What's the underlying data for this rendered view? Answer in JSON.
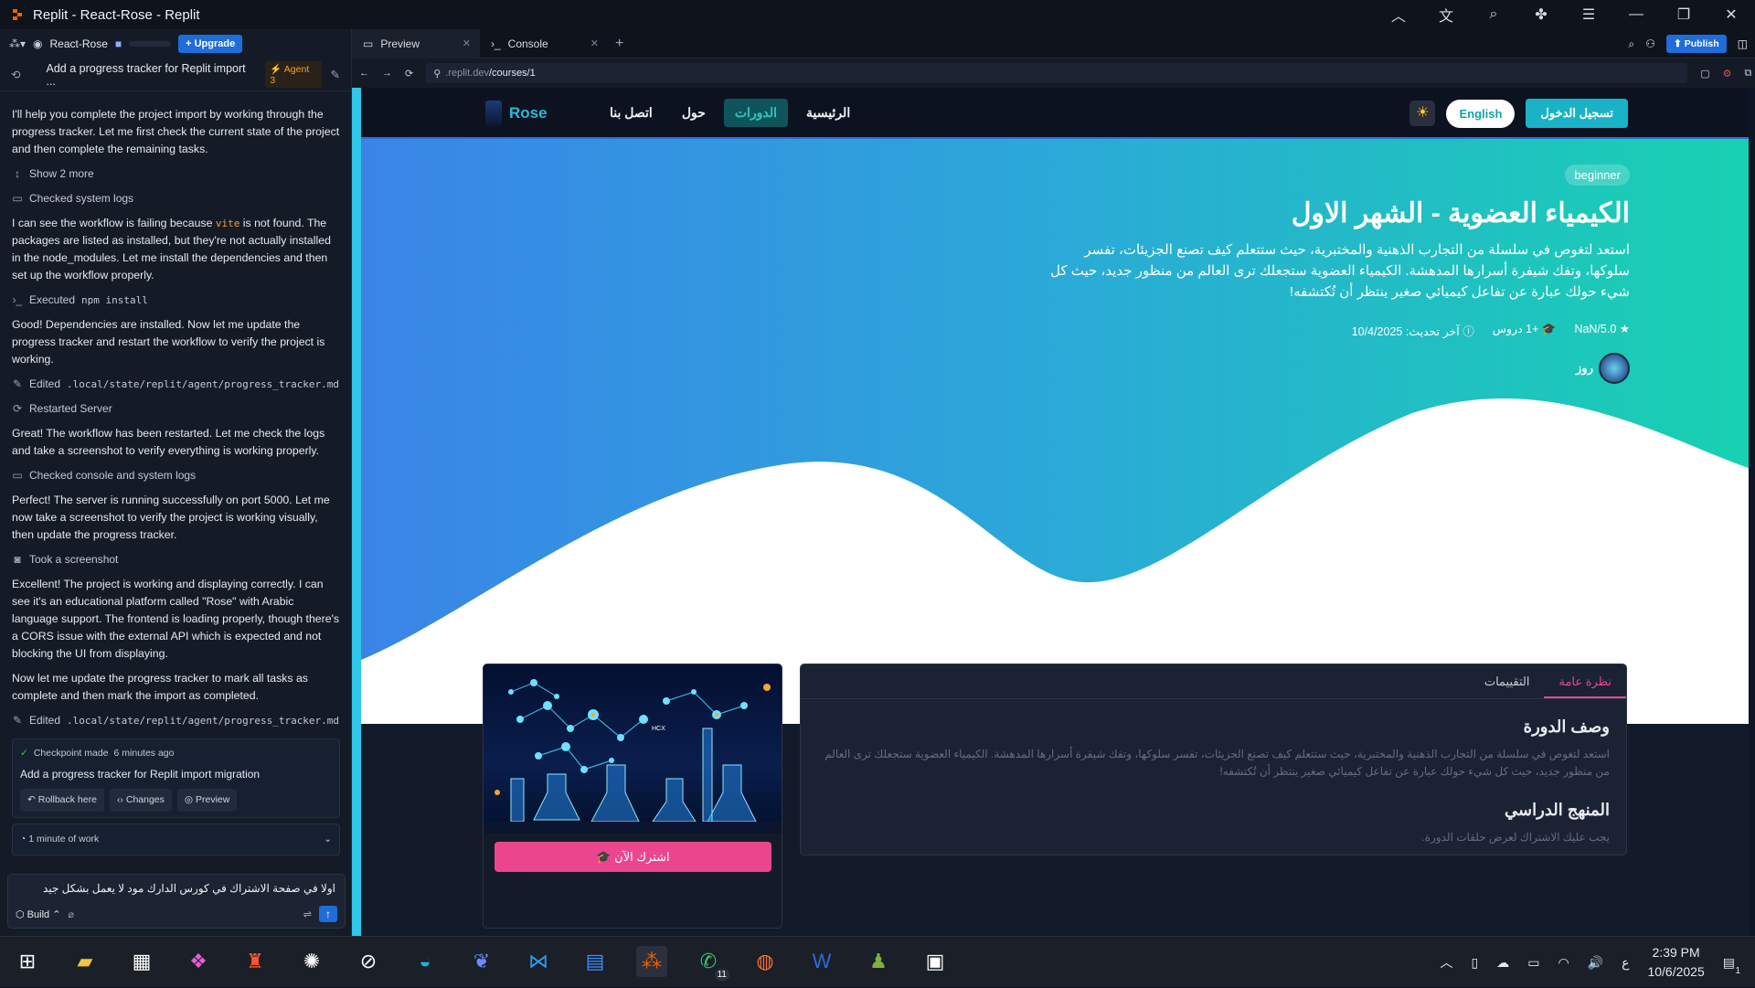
{
  "window": {
    "title": "Replit - React-Rose - Replit"
  },
  "left": {
    "project": "React-Rose",
    "upgrade": "+ Upgrade",
    "thread_title": "Add a progress tracker for Replit import ...",
    "agent_badge": "Agent 3",
    "messages": [
      {
        "type": "text",
        "text": "I'll help you complete the project import by working through the progress tracker. Let me first check the current state of the project and then complete the remaining tasks."
      },
      {
        "type": "action",
        "icon": "expand-icon",
        "text": "Show 2 more"
      },
      {
        "type": "action",
        "icon": "terminal-icon",
        "text": "Checked system logs"
      },
      {
        "type": "text_vite",
        "pre": "I can see the workflow is failing because",
        "code": "vite",
        "post": "is not found. The packages are listed as installed, but they're not actually installed in the node_modules. Let me install the dependencies and then set up the workflow properly."
      },
      {
        "type": "action",
        "icon": "terminal-icon",
        "text": "Executed",
        "code": "npm install"
      },
      {
        "type": "text",
        "text": "Good! Dependencies are installed. Now let me update the progress tracker and restart the workflow to verify the project is working."
      },
      {
        "type": "action",
        "icon": "edit-icon",
        "text": "Edited",
        "code": ".local/state/replit/agent/progress_tracker.md"
      },
      {
        "type": "action",
        "icon": "restart-icon",
        "text": "Restarted Server"
      },
      {
        "type": "text",
        "text": "Great! The workflow has been restarted. Let me check the logs and take a screenshot to verify everything is working properly."
      },
      {
        "type": "action",
        "icon": "terminal-icon",
        "text": "Checked console and system logs"
      },
      {
        "type": "text",
        "text": "Perfect! The server is running successfully on port 5000. Let me now take a screenshot to verify the project is working visually, then update the progress tracker."
      },
      {
        "type": "action",
        "icon": "camera-icon",
        "text": "Took a screenshot"
      },
      {
        "type": "text",
        "text": "Excellent! The project is working and displaying correctly. I can see it's an educational platform called \"Rose\" with Arabic language support. The frontend is loading properly, though there's a CORS issue with the external API which is expected and not blocking the UI from displaying."
      },
      {
        "type": "text",
        "text": "Now let me update the progress tracker to mark all tasks as complete and then mark the import as completed."
      },
      {
        "type": "action",
        "icon": "edit-icon",
        "text": "Edited",
        "code": ".local/state/replit/agent/progress_tracker.md"
      }
    ],
    "checkpoint": {
      "label": "Checkpoint made",
      "time": "6 minutes ago",
      "title": "Add a progress tracker for Replit import migration",
      "buttons": [
        "Rollback here",
        "Changes",
        "Preview"
      ]
    },
    "work": "1 minute of work",
    "composer": {
      "text": "اولا في صفحة الاشتراك في كورس الدارك مود لا يعمل بشكل جيد",
      "mode": "Build"
    }
  },
  "tabs": [
    {
      "label": "Preview"
    },
    {
      "label": "Console"
    }
  ],
  "publish": "Publish",
  "url": {
    "prefix": ".replit.dev",
    "path": "/courses/1"
  },
  "site": {
    "brand": "Rose",
    "nav": [
      "اتصل بنا",
      "حول",
      "الدورات",
      "الرئيسية"
    ],
    "active_nav": "الدورات",
    "english": "English",
    "login": "تسجيل الدخول",
    "badge": "beginner",
    "title": "الكيمياء العضوية - الشهر الاول",
    "desc": "استعد لتغوص في سلسلة من التجارب الذهنية والمختبرية، حيث ستتعلم كيف تصنع الجزيئات، تفسر سلوكها، وتفك شيفرة أسرارها المدهشة. الكيمياء العضوية ستجعلك ترى العالم من منظور جديد، حيث كل شيء حولك عبارة عن تفاعل كيميائي صغير ينتظر أن تُكتشفه!",
    "rating": "NaN/5.0",
    "lessons": "+1 دروس",
    "updated": "آخر تحديث: 10/4/2025",
    "author": "روز",
    "subscribe": "اشترك الآن",
    "tabs": [
      "التقييمات",
      "نظرة عامة"
    ],
    "active_tab": "نظرة عامة",
    "desc_heading": "وصف الدورة",
    "desc_text": "استعد لتغوص في سلسلة من التجارب الذهنية والمختبرية، حيث ستتعلم كيف تصنع الجزيئات، تفسر سلوكها، وتفك شيفرة أسرارها المدهشة. الكيمياء العضوية ستجعلك ترى العالم من منظور جديد، حيث كل شيء حولك عبارة عن تفاعل كيميائي صغير ينتظر أن تُكتشفه!",
    "curriculum_heading": "المنهج الدراسي",
    "curriculum_text": "يجب عليك الاشتراك لعرض حلقات الدورة.",
    "hcx": "HCX"
  },
  "taskbar": {
    "time": "2:39 PM",
    "date": "10/6/2025",
    "lang": "ع",
    "whatsapp_badge": "11",
    "notif_badge": "1"
  }
}
